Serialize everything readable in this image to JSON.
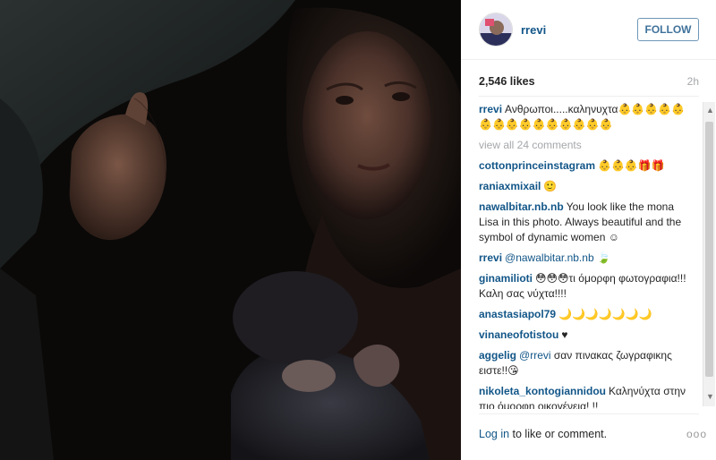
{
  "post": {
    "username": "rrevi",
    "follow_label": "FOLLOW",
    "likes": "2,546 likes",
    "time": "2h"
  },
  "caption": {
    "user": "rrevi",
    "text": "Ανθρωποι.....καληνυχτα👶👶👶👶👶👶👶👶👶👶👶👶👶👶👶"
  },
  "view_all": "view all 24 comments",
  "comments": [
    {
      "user": "cottonprinceinstagram",
      "text": "👶👶👶🎁🎁"
    },
    {
      "user": "raniaxmixail",
      "text": "🙂"
    },
    {
      "user": "nawalbitar.nb.nb",
      "text": "You look like the mona Lisa in this photo. Always beautiful and the symbol of dynamic women ☺"
    },
    {
      "user": "rrevi",
      "mention": "@nawalbitar.nb.nb",
      "text": "🍃"
    },
    {
      "user": "ginamilioti",
      "text": "😳😳😳τι όμορφη φωτογραφια!!! Καλη σας νύχτα!!!!"
    },
    {
      "user": "anastasiapol79",
      "text": "🌙🌙🌙🌙🌙🌙🌙"
    },
    {
      "user": "vinaneofotistou",
      "text": "♥"
    },
    {
      "user": "aggelig",
      "mention": "@rrevi",
      "text": "σαν πινακας ζωγραφικης ειστε!!😘"
    },
    {
      "user": "nikoleta_kontogiannidou",
      "text": "Καληνύχτα στην πιο όμορφη οικογένεια! !!"
    }
  ],
  "footer": {
    "login_link": "Log in",
    "login_rest": " to like or comment.",
    "more": "ooo"
  }
}
